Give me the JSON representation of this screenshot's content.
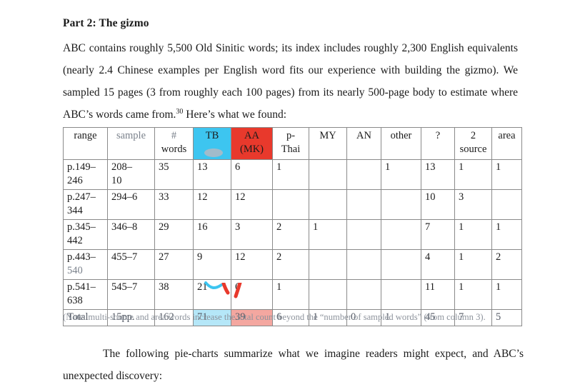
{
  "document": {
    "heading": "Part 2: The gizmo",
    "paragraph_top": "ABC contains roughly 5,500 Old Sinitic words; its index includes roughly 2,300 English equivalents (nearly 2.4 Chinese examples per English word fits our experience with building the gizmo). We sampled 15 pages (3 from roughly each 100 pages) from its nearly 500-page body to estimate where ABC’s words came from.",
    "footnote_marker": "30",
    "paragraph_top_tail": " Here’s what we found:",
    "note": "(Note: multi-source and area words increase the total count beyond the “number of sampled words” (from column 3).",
    "paragraph_bottom": "The following pie-charts summarize what we imagine readers might expect, and ABC’s unexpected discovery:"
  },
  "colors": {
    "tb_header_bg": "#3dc5f0",
    "aa_header_bg": "#e8392c",
    "tb_total_bg": "#b5e7f8",
    "aa_total_bg": "#f4a7a0",
    "artifact_red": "#e8392c",
    "table_border": "#8a8a8a",
    "note_text": "#8d939c"
  },
  "table": {
    "headers": [
      {
        "line1": "range",
        "line2": ""
      },
      {
        "line1": "sample",
        "line2": ""
      },
      {
        "line1": "#",
        "line2": "words"
      },
      {
        "line1": "TB",
        "line2": ""
      },
      {
        "line1": "AA",
        "line2": "(MK)"
      },
      {
        "line1": "p-",
        "line2": "Thai"
      },
      {
        "line1": "MY",
        "line2": ""
      },
      {
        "line1": "AN",
        "line2": ""
      },
      {
        "line1": "other",
        "line2": ""
      },
      {
        "line1": "?",
        "line2": ""
      },
      {
        "line1": "2",
        "line2": "source"
      },
      {
        "line1": "area",
        "line2": ""
      }
    ],
    "rows": [
      {
        "range_line1": "p.149–",
        "range_line2": "246",
        "sample_line1": "208–",
        "sample_line2": "10",
        "words": "35",
        "tb": "13",
        "aa": "6",
        "p_thai": "1",
        "my": "",
        "an": "",
        "other": "1",
        "unknown": "13",
        "two_source": "1",
        "area": "1"
      },
      {
        "range_line1": "p.247–",
        "range_line2": "344",
        "sample_line1": "294–6",
        "sample_line2": "",
        "words": "33",
        "tb": "12",
        "aa": "12",
        "p_thai": "",
        "my": "",
        "an": "",
        "other": "",
        "unknown": "10",
        "two_source": "3",
        "area": ""
      },
      {
        "range_line1": "p.345–",
        "range_line2": "442",
        "sample_line1": "346–8",
        "sample_line2": "",
        "words": "29",
        "tb": "16",
        "aa": "3",
        "p_thai": "2",
        "my": "1",
        "an": "",
        "other": "",
        "unknown": "7",
        "two_source": "1",
        "area": "1"
      },
      {
        "range_line1": "p.443–",
        "range_line2": "540",
        "sample_line1": "455–7",
        "sample_line2": "",
        "words": "27",
        "tb": "9",
        "aa": "12",
        "p_thai": "2",
        "my": "",
        "an": "",
        "other": "",
        "unknown": "4",
        "two_source": "1",
        "area": "2"
      },
      {
        "range_line1": "p.541–",
        "range_line2": "638",
        "sample_line1": "545–7",
        "sample_line2": "",
        "words": "38",
        "tb": "21",
        "aa": "6",
        "p_thai": "1",
        "my": "",
        "an": "",
        "other": "",
        "unknown": "11",
        "two_source": "1",
        "area": "1"
      }
    ],
    "total_row": {
      "range": "Total",
      "sample": "15pp.",
      "words": "162",
      "tb": "71",
      "aa": "39",
      "p_thai": "6",
      "my": "1",
      "an": "0",
      "other": "1",
      "unknown": "45",
      "two_source": "7",
      "area": "5"
    }
  }
}
